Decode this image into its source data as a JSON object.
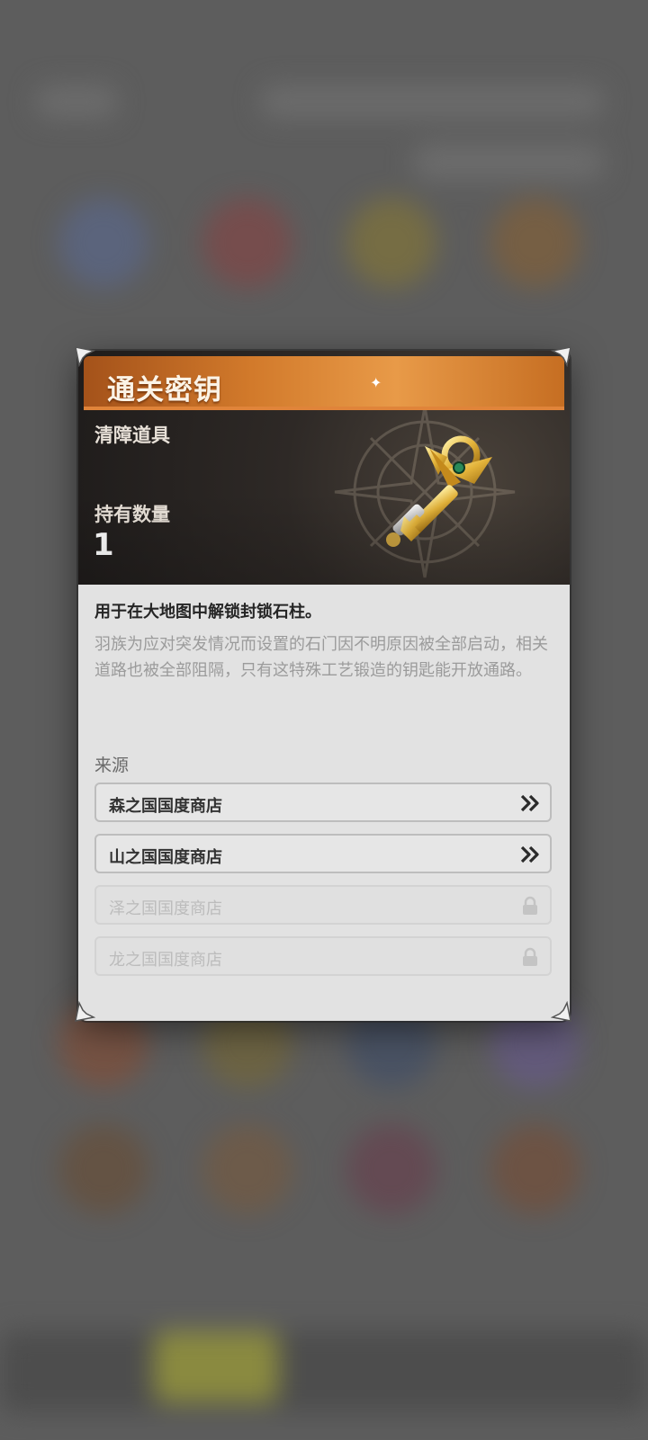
{
  "item": {
    "title": "通关密钥",
    "category": "清障道具",
    "quantity_label": "持有数量",
    "quantity_value": "1",
    "description": "用于在大地图中解锁封锁石柱。",
    "flavor_text": "羽族为应对突发情况而设置的石门因不明原因被全部启动，相关道路也被全部阻隔，只有这特殊工艺锻造的钥匙能开放通路。",
    "icon": "golden-key-icon"
  },
  "sources": {
    "label": "来源",
    "items": [
      {
        "name": "森之国国度商店",
        "state": "available",
        "icon": "double-chevron-right-icon"
      },
      {
        "name": "山之国国度商店",
        "state": "available",
        "icon": "double-chevron-right-icon"
      },
      {
        "name": "泽之国国度商店",
        "state": "locked",
        "icon": "lock-icon"
      },
      {
        "name": "龙之国国度商店",
        "state": "locked",
        "icon": "lock-icon"
      }
    ]
  },
  "colors": {
    "title_bar": "#d27a2b",
    "header_bg": "#2e2926",
    "panel_bg": "#e2e2e2",
    "overlay_bg": "#5d5d5d"
  }
}
